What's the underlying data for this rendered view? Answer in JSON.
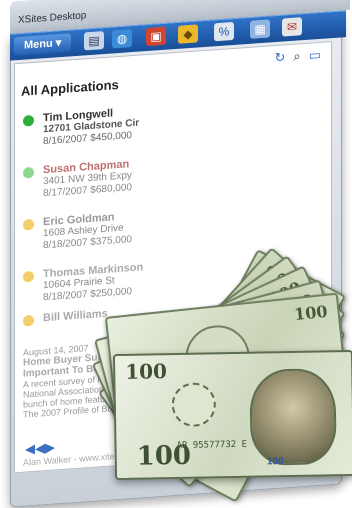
{
  "window": {
    "title": "XSites Desktop",
    "controls": [
      "_",
      "□",
      "✕"
    ]
  },
  "toolbar": {
    "menu_label": "Menu",
    "icons": [
      "document-icon",
      "globe-icon",
      "gift-icon",
      "tag-icon",
      "percent-icon",
      "calendar-icon",
      "mail-icon"
    ]
  },
  "panel": {
    "header": "All Applications",
    "entries": [
      {
        "name": "Tim Longwell",
        "address": "12701 Gladstone Cir",
        "date": "8/16/2007",
        "amount": "$450,000",
        "status_color": "#2fae3a"
      },
      {
        "name": "Susan Chapman",
        "address": "3401 NW 39th Expy",
        "date": "8/17/2007",
        "amount": "$680,000",
        "status_color": "#8ed98f"
      },
      {
        "name": "Eric Goldman",
        "address": "1608 Ashley Drive",
        "date": "8/18/2007",
        "amount": "$375,000",
        "status_color": "#f2cf6a"
      },
      {
        "name": "Thomas Markinson",
        "address": "10604 Prairie St",
        "date": "8/18/2007",
        "amount": "$250,000",
        "status_color": "#f2cf6a"
      },
      {
        "name": "Bill Williams",
        "address": "",
        "date": "",
        "amount": "",
        "status_color": "#f2cf6a"
      }
    ],
    "news": {
      "date": "August 14, 2007",
      "headline_1": "Home Buyer Survey",
      "headline_2": "Important To Buyers",
      "body_1": "A recent survey of recent home",
      "body_2": "National Association of Realtors",
      "body_3": "bunch of home features that",
      "body_4": "The 2007 Profile of Buyers"
    },
    "footer": "Alan Walker - www.xitesrealty.com"
  },
  "money": {
    "note_denomination": "100",
    "front_serial": "AB 95577732 E",
    "front_ribbon": "100"
  }
}
